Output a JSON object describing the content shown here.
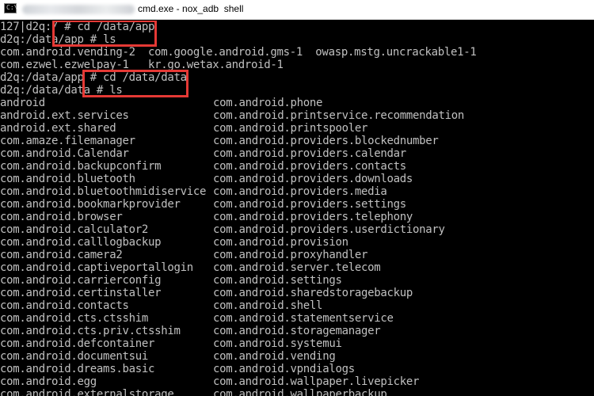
{
  "titlebar": {
    "icon_text": "C:\\",
    "title": "cmd.exe - nox_adb  shell"
  },
  "terminal": {
    "lines": [
      "127|d2q:/ # cd /data/app",
      "d2q:/data/app # ls",
      "com.android.vending-2  com.google.android.gms-1  owasp.mstg.uncrackable1-1",
      "com.ezwel.ezwelpay-1   kr.go.wetax.android-1",
      "d2q:/data/app # cd /data/data",
      "d2q:/data/data # ls"
    ],
    "listing_left": [
      "android",
      "android.ext.services",
      "android.ext.shared",
      "com.amaze.filemanager",
      "com.android.Calendar",
      "com.android.backupconfirm",
      "com.android.bluetooth",
      "com.android.bluetoothmidiservice",
      "com.android.bookmarkprovider",
      "com.android.browser",
      "com.android.calculator2",
      "com.android.calllogbackup",
      "com.android.camera2",
      "com.android.captiveportallogin",
      "com.android.carrierconfig",
      "com.android.certinstaller",
      "com.android.contacts",
      "com.android.cts.ctsshim",
      "com.android.cts.priv.ctsshim",
      "com.android.defcontainer",
      "com.android.documentsui",
      "com.android.dreams.basic",
      "com.android.egg",
      "com.android.externalstorage"
    ],
    "listing_right": [
      "com.android.phone",
      "com.android.printservice.recommendation",
      "com.android.printspooler",
      "com.android.providers.blockednumber",
      "com.android.providers.calendar",
      "com.android.providers.contacts",
      "com.android.providers.downloads",
      "com.android.providers.media",
      "com.android.providers.settings",
      "com.android.providers.telephony",
      "com.android.providers.userdictionary",
      "com.android.provision",
      "com.android.proxyhandler",
      "com.android.server.telecom",
      "com.android.settings",
      "com.android.sharedstoragebackup",
      "com.android.shell",
      "com.android.statementservice",
      "com.android.storagemanager",
      "com.android.systemui",
      "com.android.vending",
      "com.android.vpndialogs",
      "com.android.wallpaper.livepicker",
      "com.android.wallpaperbackup"
    ]
  }
}
